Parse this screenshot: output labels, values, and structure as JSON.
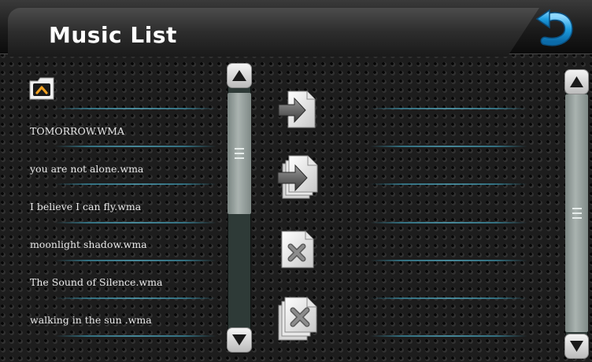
{
  "header": {
    "title": "Music List",
    "back_icon": "back-arrow-icon",
    "back_icon_color": "#1e9ee0"
  },
  "left_panel": {
    "folder_up_icon": "folder-up-icon",
    "folder_icon_color": "#f0a020",
    "files": [
      {
        "name": "TOMORROW.WMA"
      },
      {
        "name": "you are not alone.wma"
      },
      {
        "name": "I believe I can fly.wma"
      },
      {
        "name": "moonlight shadow.wma"
      },
      {
        "name": "The Sound of Silence.wma"
      },
      {
        "name": "walking in the sun .wma"
      }
    ]
  },
  "actions": [
    {
      "name": "add-file-to-playlist",
      "icon": "file-arrow-icon"
    },
    {
      "name": "add-all-files-to-playlist",
      "icon": "files-arrow-icon"
    },
    {
      "name": "remove-file",
      "icon": "file-delete-icon"
    },
    {
      "name": "remove-all-files",
      "icon": "files-delete-icon"
    }
  ],
  "right_panel": {
    "files": []
  },
  "scrollbars": {
    "left": {
      "up_icon": "triangle-up-icon",
      "down_icon": "triangle-down-icon"
    },
    "right": {
      "up_icon": "triangle-up-icon",
      "down_icon": "triangle-down-icon"
    }
  },
  "colors": {
    "accent_line": "#3a8aa0",
    "text": "#e8e8e8"
  }
}
